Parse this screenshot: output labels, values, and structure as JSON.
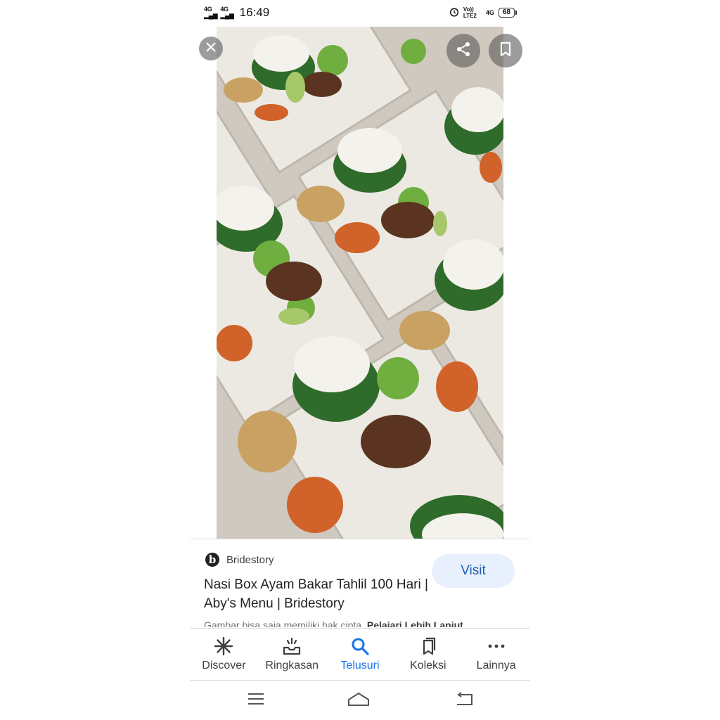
{
  "status_bar": {
    "signal_1": "4G",
    "signal_2": "4G",
    "time": "16:49",
    "volte": "Vo)) LTE2",
    "net": "4G",
    "battery": "68",
    "alarm_icon": "alarm-icon"
  },
  "viewer": {
    "close_icon": "close-icon",
    "share_icon": "share-icon",
    "bookmark_icon": "bookmark-icon"
  },
  "result": {
    "source_logo": "b",
    "source_name": "Bridestory",
    "title": "Nasi Box Ayam Bakar Tahlil 100 Hari | Aby's Menu | Bridestory",
    "visit_label": "Visit",
    "snippet_prefix": "Gambar bisa saja memiliki hak cipta. ",
    "snippet_link": "Pelajari Lebih Lanjut"
  },
  "bottom_nav": {
    "items": [
      {
        "label": "Discover",
        "icon": "discover-icon"
      },
      {
        "label": "Ringkasan",
        "icon": "ringkasan-icon"
      },
      {
        "label": "Telusuri",
        "icon": "search-icon"
      },
      {
        "label": "Koleksi",
        "icon": "collections-icon"
      },
      {
        "label": "Lainnya",
        "icon": "more-icon"
      }
    ],
    "active_index": 2
  },
  "system_nav": {
    "menu_icon": "menu-icon",
    "home_icon": "home-icon",
    "back_icon": "back-icon"
  },
  "colors": {
    "accent": "#1a73e8",
    "visit_bg": "#e8f0fe"
  }
}
